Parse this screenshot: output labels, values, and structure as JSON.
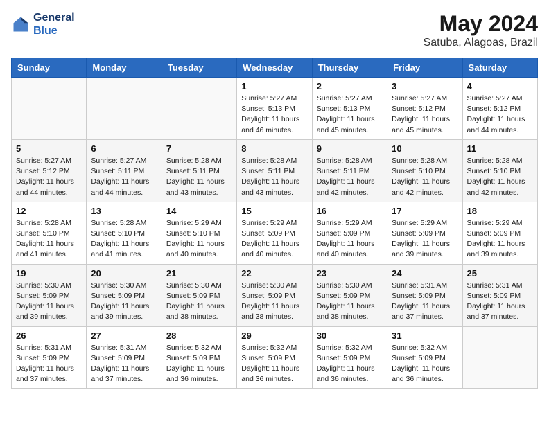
{
  "logo": {
    "line1": "General",
    "line2": "Blue"
  },
  "title": "May 2024",
  "location": "Satuba, Alagoas, Brazil",
  "days_header": [
    "Sunday",
    "Monday",
    "Tuesday",
    "Wednesday",
    "Thursday",
    "Friday",
    "Saturday"
  ],
  "weeks": [
    [
      {
        "day": "",
        "info": ""
      },
      {
        "day": "",
        "info": ""
      },
      {
        "day": "",
        "info": ""
      },
      {
        "day": "1",
        "info": "Sunrise: 5:27 AM\nSunset: 5:13 PM\nDaylight: 11 hours\nand 46 minutes."
      },
      {
        "day": "2",
        "info": "Sunrise: 5:27 AM\nSunset: 5:13 PM\nDaylight: 11 hours\nand 45 minutes."
      },
      {
        "day": "3",
        "info": "Sunrise: 5:27 AM\nSunset: 5:12 PM\nDaylight: 11 hours\nand 45 minutes."
      },
      {
        "day": "4",
        "info": "Sunrise: 5:27 AM\nSunset: 5:12 PM\nDaylight: 11 hours\nand 44 minutes."
      }
    ],
    [
      {
        "day": "5",
        "info": "Sunrise: 5:27 AM\nSunset: 5:12 PM\nDaylight: 11 hours\nand 44 minutes."
      },
      {
        "day": "6",
        "info": "Sunrise: 5:27 AM\nSunset: 5:11 PM\nDaylight: 11 hours\nand 44 minutes."
      },
      {
        "day": "7",
        "info": "Sunrise: 5:28 AM\nSunset: 5:11 PM\nDaylight: 11 hours\nand 43 minutes."
      },
      {
        "day": "8",
        "info": "Sunrise: 5:28 AM\nSunset: 5:11 PM\nDaylight: 11 hours\nand 43 minutes."
      },
      {
        "day": "9",
        "info": "Sunrise: 5:28 AM\nSunset: 5:11 PM\nDaylight: 11 hours\nand 42 minutes."
      },
      {
        "day": "10",
        "info": "Sunrise: 5:28 AM\nSunset: 5:10 PM\nDaylight: 11 hours\nand 42 minutes."
      },
      {
        "day": "11",
        "info": "Sunrise: 5:28 AM\nSunset: 5:10 PM\nDaylight: 11 hours\nand 42 minutes."
      }
    ],
    [
      {
        "day": "12",
        "info": "Sunrise: 5:28 AM\nSunset: 5:10 PM\nDaylight: 11 hours\nand 41 minutes."
      },
      {
        "day": "13",
        "info": "Sunrise: 5:28 AM\nSunset: 5:10 PM\nDaylight: 11 hours\nand 41 minutes."
      },
      {
        "day": "14",
        "info": "Sunrise: 5:29 AM\nSunset: 5:10 PM\nDaylight: 11 hours\nand 40 minutes."
      },
      {
        "day": "15",
        "info": "Sunrise: 5:29 AM\nSunset: 5:09 PM\nDaylight: 11 hours\nand 40 minutes."
      },
      {
        "day": "16",
        "info": "Sunrise: 5:29 AM\nSunset: 5:09 PM\nDaylight: 11 hours\nand 40 minutes."
      },
      {
        "day": "17",
        "info": "Sunrise: 5:29 AM\nSunset: 5:09 PM\nDaylight: 11 hours\nand 39 minutes."
      },
      {
        "day": "18",
        "info": "Sunrise: 5:29 AM\nSunset: 5:09 PM\nDaylight: 11 hours\nand 39 minutes."
      }
    ],
    [
      {
        "day": "19",
        "info": "Sunrise: 5:30 AM\nSunset: 5:09 PM\nDaylight: 11 hours\nand 39 minutes."
      },
      {
        "day": "20",
        "info": "Sunrise: 5:30 AM\nSunset: 5:09 PM\nDaylight: 11 hours\nand 39 minutes."
      },
      {
        "day": "21",
        "info": "Sunrise: 5:30 AM\nSunset: 5:09 PM\nDaylight: 11 hours\nand 38 minutes."
      },
      {
        "day": "22",
        "info": "Sunrise: 5:30 AM\nSunset: 5:09 PM\nDaylight: 11 hours\nand 38 minutes."
      },
      {
        "day": "23",
        "info": "Sunrise: 5:30 AM\nSunset: 5:09 PM\nDaylight: 11 hours\nand 38 minutes."
      },
      {
        "day": "24",
        "info": "Sunrise: 5:31 AM\nSunset: 5:09 PM\nDaylight: 11 hours\nand 37 minutes."
      },
      {
        "day": "25",
        "info": "Sunrise: 5:31 AM\nSunset: 5:09 PM\nDaylight: 11 hours\nand 37 minutes."
      }
    ],
    [
      {
        "day": "26",
        "info": "Sunrise: 5:31 AM\nSunset: 5:09 PM\nDaylight: 11 hours\nand 37 minutes."
      },
      {
        "day": "27",
        "info": "Sunrise: 5:31 AM\nSunset: 5:09 PM\nDaylight: 11 hours\nand 37 minutes."
      },
      {
        "day": "28",
        "info": "Sunrise: 5:32 AM\nSunset: 5:09 PM\nDaylight: 11 hours\nand 36 minutes."
      },
      {
        "day": "29",
        "info": "Sunrise: 5:32 AM\nSunset: 5:09 PM\nDaylight: 11 hours\nand 36 minutes."
      },
      {
        "day": "30",
        "info": "Sunrise: 5:32 AM\nSunset: 5:09 PM\nDaylight: 11 hours\nand 36 minutes."
      },
      {
        "day": "31",
        "info": "Sunrise: 5:32 AM\nSunset: 5:09 PM\nDaylight: 11 hours\nand 36 minutes."
      },
      {
        "day": "",
        "info": ""
      }
    ]
  ]
}
